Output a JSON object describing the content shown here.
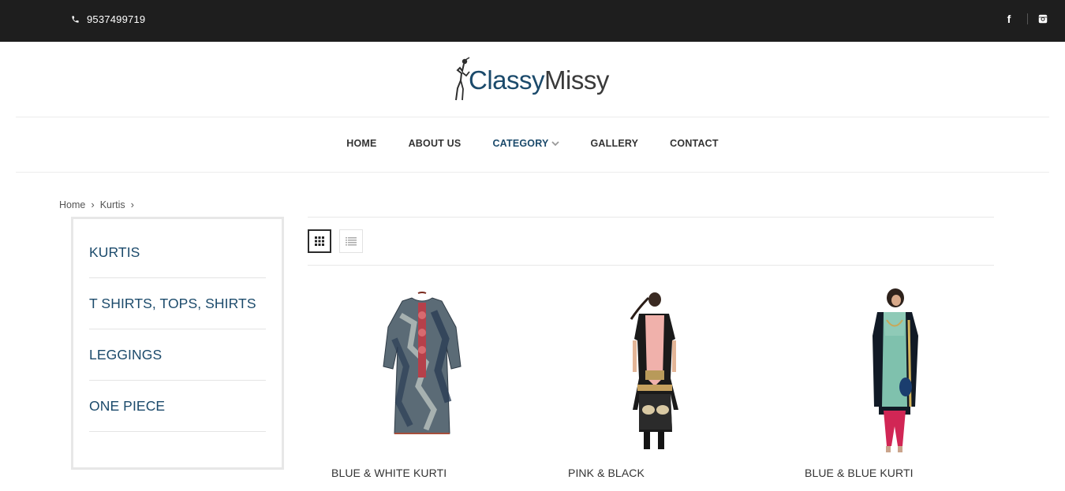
{
  "topbar": {
    "phone": "9537499719",
    "social_icons": [
      "facebook-icon",
      "instagram-icon"
    ]
  },
  "logo": {
    "part1": "Classy",
    "part2": "Missy"
  },
  "nav": {
    "items": [
      {
        "label": "HOME"
      },
      {
        "label": "ABOUT US"
      },
      {
        "label": "CATEGORY",
        "active": true,
        "has_dropdown": true
      },
      {
        "label": "GALLERY"
      },
      {
        "label": "CONTACT"
      }
    ]
  },
  "breadcrumb": [
    "Home",
    "Kurtis"
  ],
  "sidebar": {
    "categories": [
      "KURTIS",
      "T SHIRTS, TOPS, SHIRTS",
      "LEGGINGS",
      "ONE PIECE"
    ]
  },
  "toolbar": {
    "views": [
      "grid-view-icon",
      "list-view-icon"
    ],
    "active_view": "grid"
  },
  "products": [
    {
      "name": "BLUE & WHITE KURTI"
    },
    {
      "name": "PINK & BLACK"
    },
    {
      "name": "BLUE & BLUE KURTI"
    }
  ],
  "colors": {
    "topbar_bg": "#1e1e1e",
    "brand_blue": "#1b4a6b",
    "text_dark": "#333333"
  }
}
